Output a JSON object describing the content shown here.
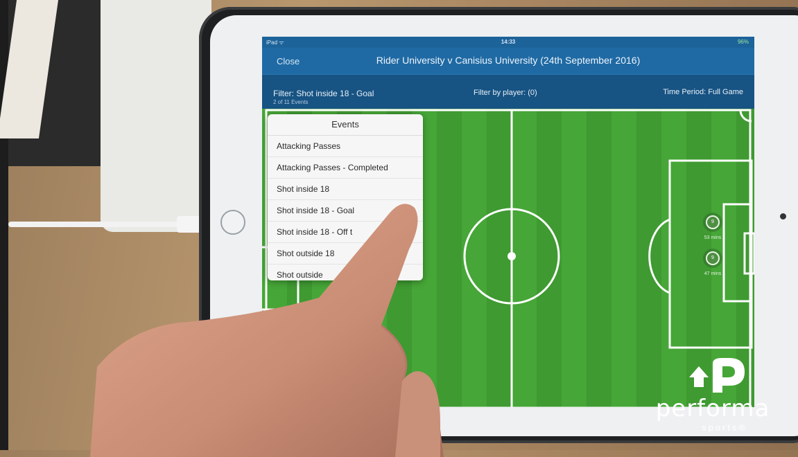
{
  "status_bar": {
    "carrier": "iPad ᯤ",
    "time": "14:33",
    "battery": "96%"
  },
  "nav": {
    "close_label": "Close",
    "title": "Rider University v Canisius University (24th September 2016)"
  },
  "filter_bar": {
    "filter_label": "Filter: Shot inside 18 - Goal",
    "filter_count": "2 of 11 Events",
    "player_filter": "Filter by player: (0)",
    "time_period": "Time Period: Full Game"
  },
  "events_popover": {
    "title": "Events",
    "items": [
      {
        "label": "Attacking Passes",
        "selected": false
      },
      {
        "label": "Attacking Passes - Completed",
        "selected": false
      },
      {
        "label": "Shot inside 18",
        "selected": false
      },
      {
        "label": "Shot inside 18 - Goal",
        "selected": true
      },
      {
        "label": "Shot inside 18 - Off t",
        "selected": false
      },
      {
        "label": "Shot outside 18",
        "selected": false
      },
      {
        "label": "Shot outside",
        "selected": false
      }
    ],
    "checkmark": "✓"
  },
  "markers": [
    {
      "number": "9",
      "time": "53 mins"
    },
    {
      "number": "9",
      "time": "47 mins"
    }
  ],
  "logo": {
    "word": "performa",
    "sub": "sports®"
  },
  "colors": {
    "nav_blue": "#1f6aa4",
    "pitch_green": "#46a637",
    "pitch_stripe": "#3f9a31"
  }
}
